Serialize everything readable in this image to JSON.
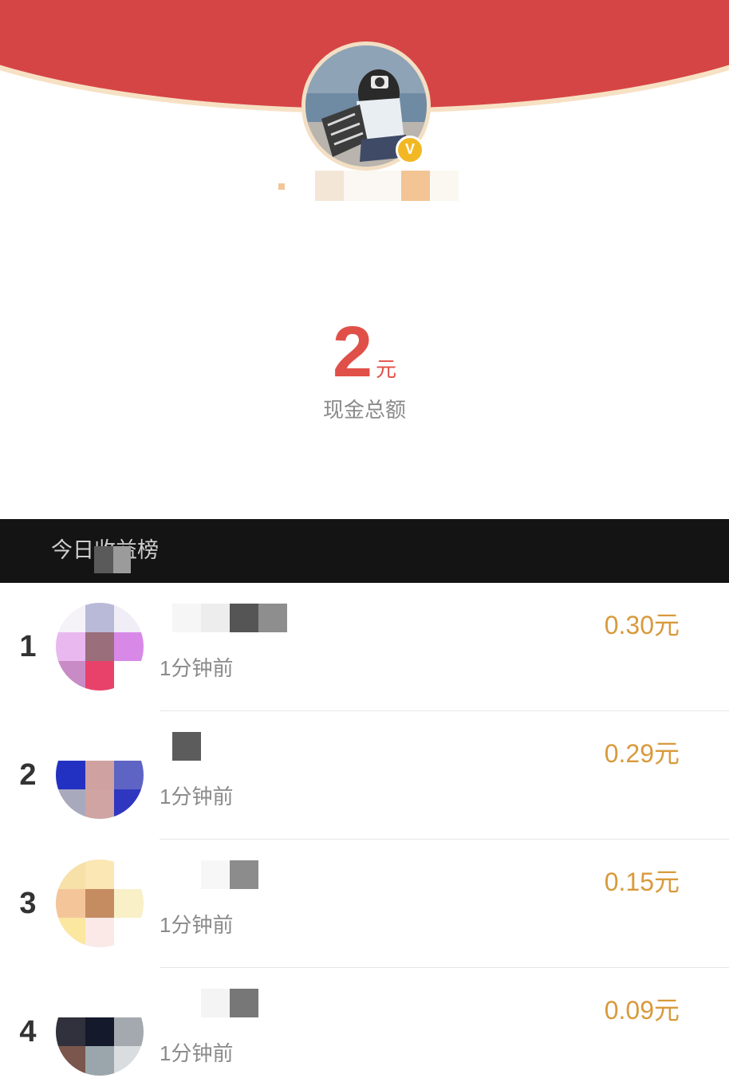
{
  "header": {
    "verified_badge": "V",
    "colors": {
      "red": "#d64545",
      "rim": "#f7e1c4",
      "badge": "#f2b824"
    }
  },
  "total": {
    "value": "2",
    "unit": "元",
    "label": "现金总额"
  },
  "ranking": {
    "title": "今日收益榜",
    "rows": [
      {
        "rank": "1",
        "time": "1分钟前",
        "amount": "0.30元"
      },
      {
        "rank": "2",
        "time": "1分钟前",
        "amount": "0.29元"
      },
      {
        "rank": "3",
        "time": "1分钟前",
        "amount": "0.15元"
      },
      {
        "rank": "4",
        "time": "1分钟前",
        "amount": "0.09元"
      }
    ]
  }
}
